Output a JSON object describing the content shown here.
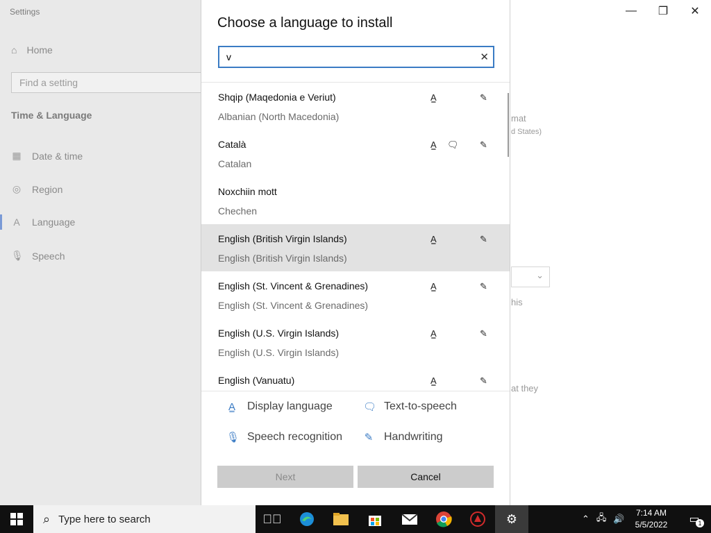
{
  "settings": {
    "window_title": "Settings",
    "home_label": "Home",
    "search_placeholder": "Find a setting",
    "section_title": "Time & Language",
    "nav": [
      {
        "label": "Date & time",
        "icon": "calendar-clock-icon"
      },
      {
        "label": "Region",
        "icon": "globe-icon"
      },
      {
        "label": "Language",
        "icon": "language-icon"
      },
      {
        "label": "Speech",
        "icon": "microphone-icon"
      }
    ],
    "right_fragments": [
      "mat",
      "d States)",
      "his",
      "at they"
    ]
  },
  "dialog": {
    "title": "Choose a language to install",
    "search_value": "v",
    "languages": [
      {
        "native": "Shqip (Maqedonia e Veriut)",
        "english": "Albanian (North Macedonia)",
        "features": [
          "display",
          "handwriting"
        ],
        "selected": false
      },
      {
        "native": "Català",
        "english": "Catalan",
        "features": [
          "display",
          "tts",
          "handwriting"
        ],
        "selected": false
      },
      {
        "native": "Noxchiin mott",
        "english": "Chechen",
        "features": [],
        "selected": false
      },
      {
        "native": "English (British Virgin Islands)",
        "english": "English (British Virgin Islands)",
        "features": [
          "display",
          "handwriting"
        ],
        "selected": true
      },
      {
        "native": "English (St. Vincent & Grenadines)",
        "english": "English (St. Vincent & Grenadines)",
        "features": [
          "display",
          "handwriting"
        ],
        "selected": false
      },
      {
        "native": "English (U.S. Virgin Islands)",
        "english": "English (U.S. Virgin Islands)",
        "features": [
          "display",
          "handwriting"
        ],
        "selected": false
      },
      {
        "native": "English (Vanuatu)",
        "english": "",
        "features": [
          "display",
          "handwriting"
        ],
        "selected": false
      }
    ],
    "legend": {
      "display": "Display language",
      "tts": "Text-to-speech",
      "speech": "Speech recognition",
      "handwriting": "Handwriting"
    },
    "next_label": "Next",
    "cancel_label": "Cancel"
  },
  "taskbar": {
    "search_placeholder": "Type here to search",
    "time": "7:14 AM",
    "date": "5/5/2022",
    "notification_count": "1"
  },
  "colors": {
    "accent": "#3a7bc4",
    "selected_row": "#e2e2e2",
    "taskbar": "#101010"
  }
}
